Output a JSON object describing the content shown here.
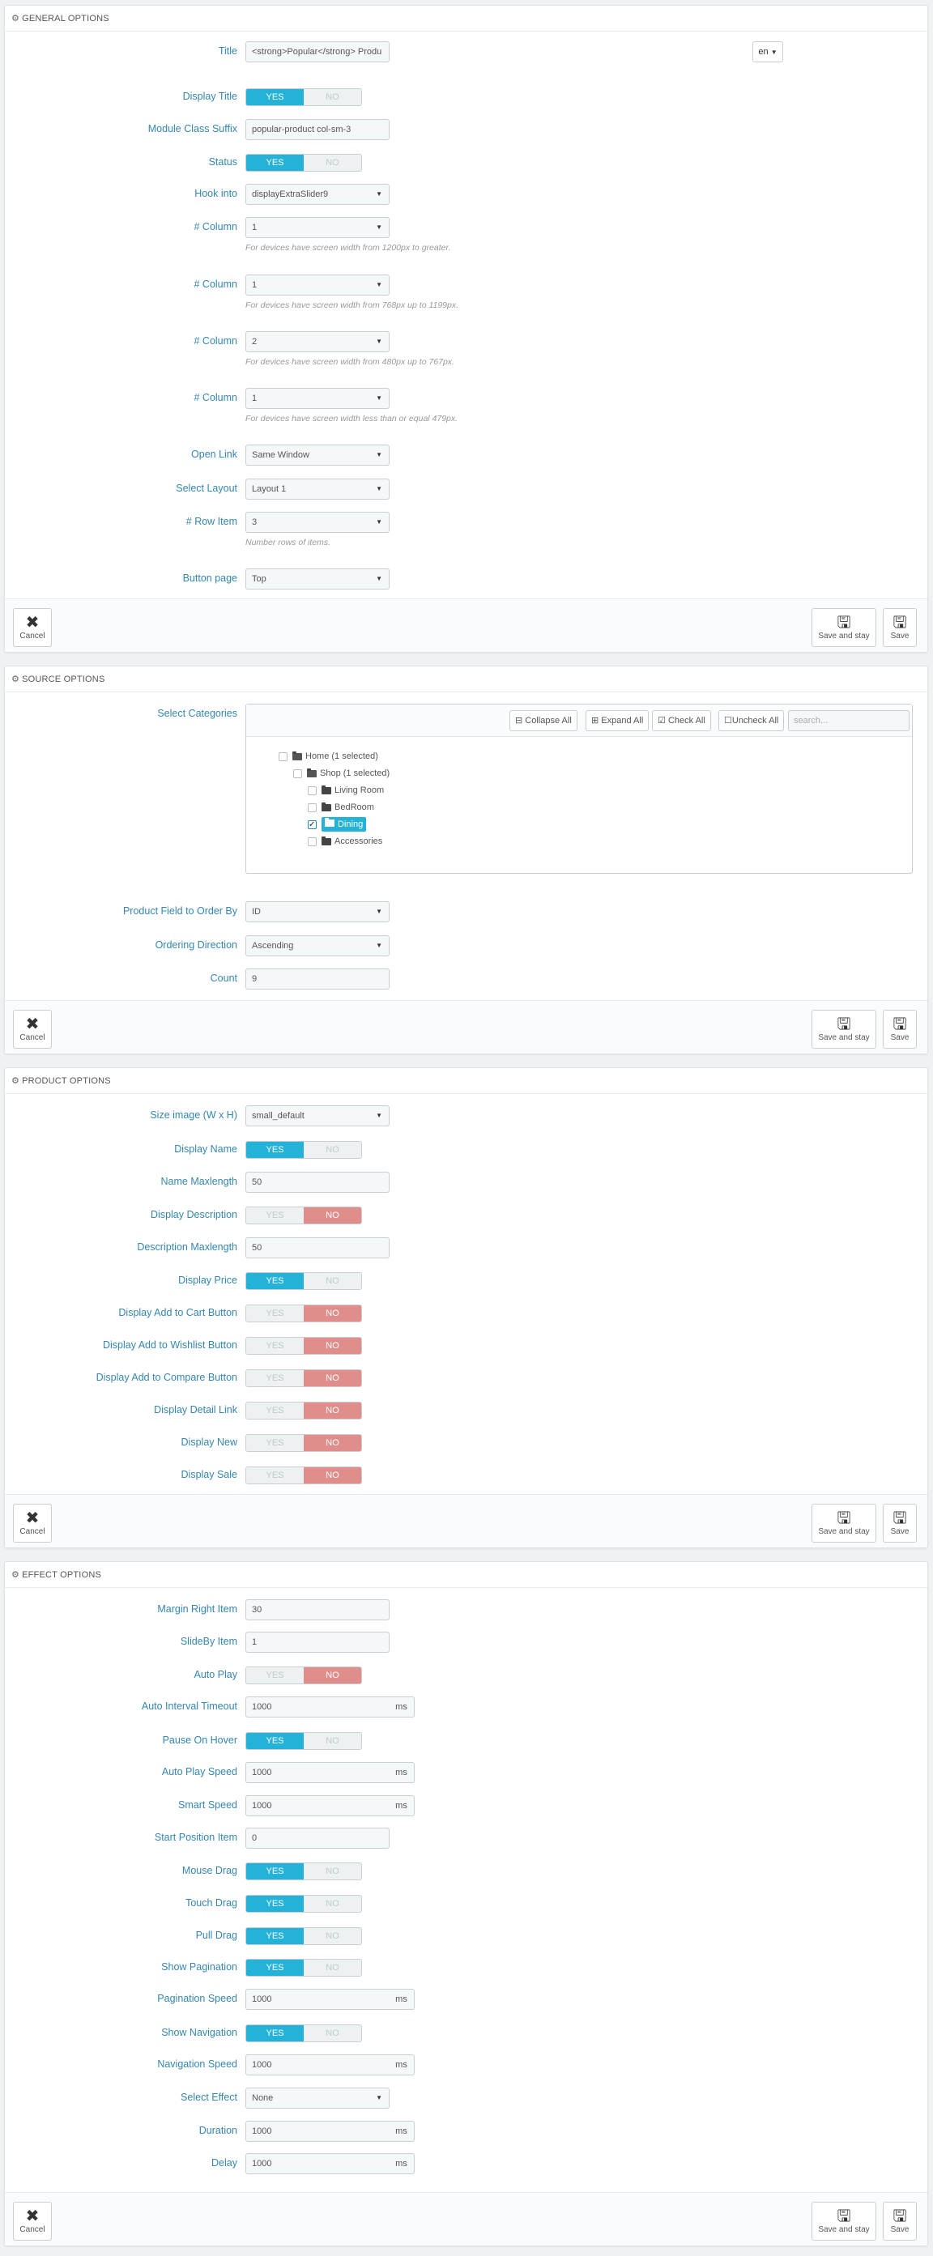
{
  "buttons": {
    "cancel": "Cancel",
    "save_stay": "Save and stay",
    "save": "Save"
  },
  "general": {
    "heading": "GENERAL OPTIONS",
    "title_label": "Title",
    "title_value": "<strong>Popular</strong> Produ",
    "lang": "en",
    "display_title": "Display Title",
    "class_suffix_label": "Module Class Suffix",
    "class_suffix_value": "popular-product col-sm-3",
    "status": "Status",
    "hook_label": "Hook into",
    "hook_value": "displayExtraSlider9",
    "column_label": "# Column",
    "col1": "1",
    "col1_hint": "For devices have screen width from 1200px to greater.",
    "col2": "1",
    "col2_hint": "For devices have screen width from 768px up to 1199px.",
    "col3": "2",
    "col3_hint": "For devices have screen width from 480px up to 767px.",
    "col4": "1",
    "col4_hint": "For devices have screen width less than or equal 479px.",
    "open_link_label": "Open Link",
    "open_link_value": "Same Window",
    "layout_label": "Select Layout",
    "layout_value": "Layout 1",
    "row_item_label": "# Row Item",
    "row_item_value": "3",
    "row_item_hint": "Number rows of items.",
    "button_page_label": "Button page",
    "button_page_value": "Top"
  },
  "source": {
    "heading": "SOURCE OPTIONS",
    "cat_label": "Select Categories",
    "collapse": "Collapse All",
    "expand": "Expand All",
    "check": "Check All",
    "uncheck": "Uncheck All",
    "search_ph": "search...",
    "tree": [
      "Home (1 selected)",
      "Shop (1 selected)",
      "Living Room",
      "BedRoom",
      "Dining",
      "Accessories"
    ],
    "order_by_label": "Product Field to Order By",
    "order_by_value": "ID",
    "direction_label": "Ordering Direction",
    "direction_value": "Ascending",
    "count_label": "Count",
    "count_value": "9"
  },
  "product": {
    "heading": "PRODUCT OPTIONS",
    "size_label": "Size image (W x H)",
    "size_value": "small_default",
    "display_name": "Display Name",
    "name_max_label": "Name Maxlength",
    "name_max_value": "50",
    "display_desc": "Display Description",
    "desc_max_label": "Description Maxlength",
    "desc_max_value": "50",
    "display_price": "Display Price",
    "add_cart": "Display Add to Cart Button",
    "add_wish": "Display Add to Wishlist Button",
    "add_compare": "Display Add to Compare Button",
    "detail_link": "Display Detail Link",
    "display_new": "Display New",
    "display_sale": "Display Sale"
  },
  "effect": {
    "heading": "EFFECT OPTIONS",
    "margin_label": "Margin Right Item",
    "margin_value": "30",
    "slideby_label": "SlideBy Item",
    "slideby_value": "1",
    "autoplay": "Auto Play",
    "interval_label": "Auto Interval Timeout",
    "interval_value": "1000",
    "pause": "Pause On Hover",
    "ap_speed_label": "Auto Play Speed",
    "ap_speed_value": "1000",
    "smart_label": "Smart Speed",
    "smart_value": "1000",
    "start_label": "Start Position Item",
    "start_value": "0",
    "mouse": "Mouse Drag",
    "touch": "Touch Drag",
    "pull": "Pull Drag",
    "show_pag": "Show Pagination",
    "pag_speed_label": "Pagination Speed",
    "pag_speed_value": "1000",
    "show_nav": "Show Navigation",
    "nav_speed_label": "Navigation Speed",
    "nav_speed_value": "1000",
    "effect_label": "Select Effect",
    "effect_value": "None",
    "duration_label": "Duration",
    "duration_value": "1000",
    "delay_label": "Delay",
    "delay_value": "1000"
  },
  "toggle": {
    "yes": "YES",
    "no": "NO"
  },
  "units": {
    "ms": "ms"
  }
}
